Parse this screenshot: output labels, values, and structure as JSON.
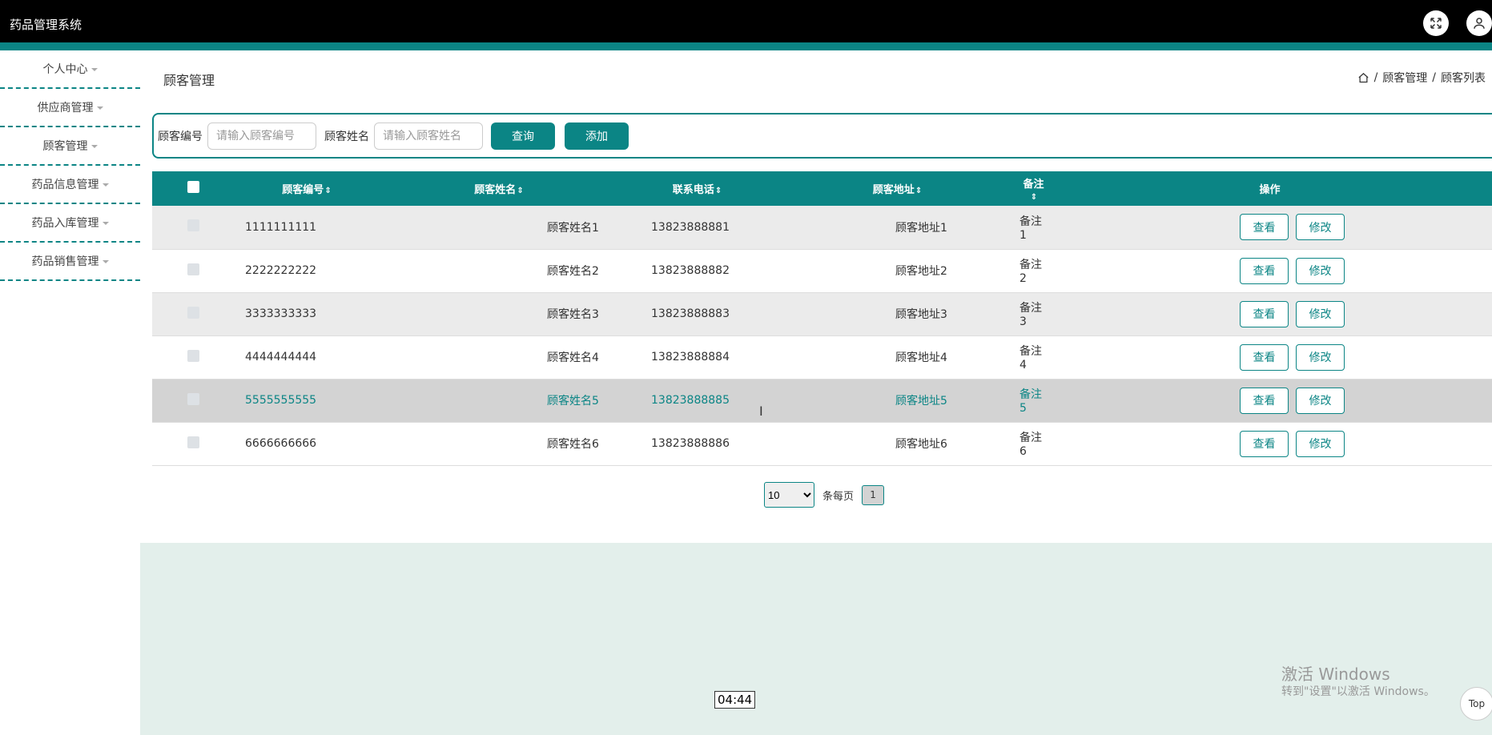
{
  "app": {
    "title": "药品管理系统"
  },
  "sidebar": {
    "items": [
      {
        "label": "个人中心"
      },
      {
        "label": "供应商管理"
      },
      {
        "label": "顾客管理"
      },
      {
        "label": "药品信息管理"
      },
      {
        "label": "药品入库管理"
      },
      {
        "label": "药品销售管理"
      }
    ]
  },
  "header": {
    "page_title": "顾客管理",
    "breadcrumb": [
      "顾客管理",
      "顾客列表"
    ],
    "separator": "/"
  },
  "search": {
    "id_label": "顾客编号",
    "id_placeholder": "请输入顾客编号",
    "name_label": "顾客姓名",
    "name_placeholder": "请输入顾客姓名",
    "query_label": "查询",
    "add_label": "添加"
  },
  "table": {
    "columns": [
      "顾客编号",
      "顾客姓名",
      "联系电话",
      "顾客地址",
      "备注",
      "操作"
    ],
    "rows": [
      {
        "id": "1111111111",
        "name": "顾客姓名1",
        "phone": "13823888881",
        "address": "顾客地址1",
        "note": "备注1"
      },
      {
        "id": "2222222222",
        "name": "顾客姓名2",
        "phone": "13823888882",
        "address": "顾客地址2",
        "note": "备注2"
      },
      {
        "id": "3333333333",
        "name": "顾客姓名3",
        "phone": "13823888883",
        "address": "顾客地址3",
        "note": "备注3"
      },
      {
        "id": "4444444444",
        "name": "顾客姓名4",
        "phone": "13823888884",
        "address": "顾客地址4",
        "note": "备注4"
      },
      {
        "id": "5555555555",
        "name": "顾客姓名5",
        "phone": "13823888885",
        "address": "顾客地址5",
        "note": "备注5"
      },
      {
        "id": "6666666666",
        "name": "顾客姓名6",
        "phone": "13823888886",
        "address": "顾客地址6",
        "note": "备注6"
      }
    ],
    "view_label": "查看",
    "edit_label": "修改"
  },
  "pagination": {
    "per_page": "10",
    "per_page_label": "条每页",
    "current_page": "1"
  },
  "overlay": {
    "watermark_title": "激活 Windows",
    "watermark_sub": "转到\"设置\"以激活 Windows。",
    "time_tip": "04:44",
    "top_label": "Top"
  },
  "colors": {
    "accent": "#0b8585",
    "topbar": "#000000",
    "footer": "#e3efeb"
  },
  "icons": [
    "fullscreen-icon",
    "user-icon",
    "home-icon",
    "caret-down-icon",
    "sort-icon"
  ]
}
